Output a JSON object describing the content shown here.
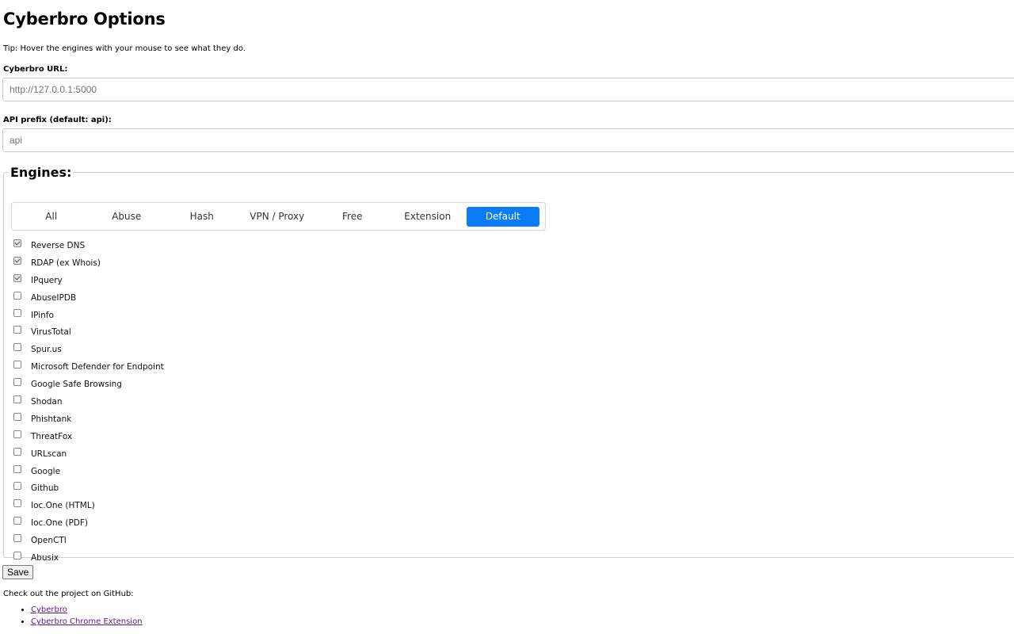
{
  "page": {
    "title": "Cyberbro Options",
    "tip": "Tip: Hover the engines with your mouse to see what they do."
  },
  "url_field": {
    "label": "Cyberbro URL:",
    "placeholder": "http://127.0.0.1:5000"
  },
  "api_field": {
    "label": "API prefix (default: api):",
    "placeholder": "api"
  },
  "engines": {
    "legend": "Engines:",
    "tabs": [
      {
        "label": "All",
        "active": false
      },
      {
        "label": "Abuse",
        "active": false
      },
      {
        "label": "Hash",
        "active": false
      },
      {
        "label": "VPN / Proxy",
        "active": false
      },
      {
        "label": "Free",
        "active": false
      },
      {
        "label": "Extension",
        "active": false
      },
      {
        "label": "Default",
        "active": true
      }
    ],
    "items": [
      {
        "label": "Reverse DNS",
        "checked": true
      },
      {
        "label": "RDAP (ex Whois)",
        "checked": true
      },
      {
        "label": "IPquery",
        "checked": true
      },
      {
        "label": "AbuseIPDB",
        "checked": false
      },
      {
        "label": "IPinfo",
        "checked": false
      },
      {
        "label": "VirusTotal",
        "checked": false
      },
      {
        "label": "Spur.us",
        "checked": false
      },
      {
        "label": "Microsoft Defender for Endpoint",
        "checked": false
      },
      {
        "label": "Google Safe Browsing",
        "checked": false
      },
      {
        "label": "Shodan",
        "checked": false
      },
      {
        "label": "Phishtank",
        "checked": false
      },
      {
        "label": "ThreatFox",
        "checked": false
      },
      {
        "label": "URLscan",
        "checked": false
      },
      {
        "label": "Google",
        "checked": false
      },
      {
        "label": "Github",
        "checked": false
      },
      {
        "label": "Ioc.One (HTML)",
        "checked": false
      },
      {
        "label": "Ioc.One (PDF)",
        "checked": false
      },
      {
        "label": "OpenCTI",
        "checked": false
      },
      {
        "label": "Abusix",
        "checked": false
      }
    ]
  },
  "save_label": "Save",
  "footer": {
    "text": "Check out the project on GitHub:",
    "links": [
      "Cyberbro",
      "Cyberbro Chrome Extension"
    ]
  },
  "colors": {
    "accent": "#0a7cf5",
    "link": "#551a8b"
  }
}
